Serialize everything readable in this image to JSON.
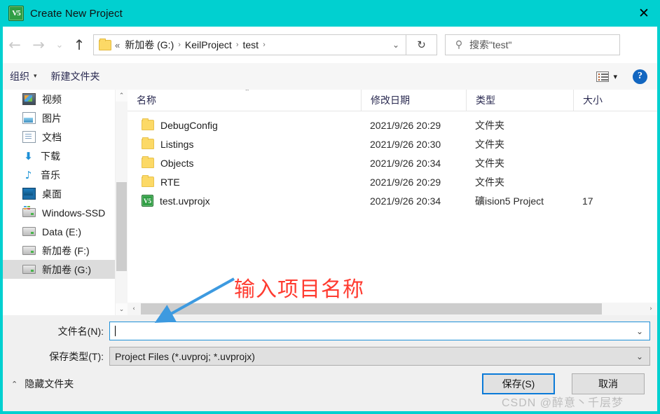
{
  "window": {
    "title": "Create New Project",
    "app_icon": "keil-uvision-icon",
    "close_label": "✕",
    "accent_color": "#01d0d0"
  },
  "nav": {
    "back": "←",
    "forward": "→",
    "recent": "⌄",
    "up": "↑",
    "refresh": "↻",
    "address_dropdown": "⌄",
    "breadcrumbs": [
      {
        "label": "«",
        "type": "overflow"
      },
      {
        "label": "新加卷 (G:)",
        "type": "crumb"
      },
      {
        "label": "KeilProject",
        "type": "crumb"
      },
      {
        "label": "test",
        "type": "crumb"
      }
    ],
    "separator": "›"
  },
  "search": {
    "icon": "search-icon",
    "placeholder": "搜索\"test\""
  },
  "toolbar": {
    "organize_label": "组织",
    "organize_caret": "▾",
    "new_folder_label": "新建文件夹",
    "view_caret": "▾",
    "help_label": "?"
  },
  "sidebar": {
    "items": [
      {
        "label": "视频",
        "icon": "video-icon",
        "selected": false
      },
      {
        "label": "图片",
        "icon": "pictures-icon",
        "selected": false
      },
      {
        "label": "文档",
        "icon": "documents-icon",
        "selected": false
      },
      {
        "label": "下载",
        "icon": "downloads-icon",
        "selected": false
      },
      {
        "label": "音乐",
        "icon": "music-icon",
        "selected": false
      },
      {
        "label": "桌面",
        "icon": "desktop-icon",
        "selected": false
      },
      {
        "label": "Windows-SSD",
        "icon": "ssd-drive-icon",
        "selected": false
      },
      {
        "label": "Data (E:)",
        "icon": "drive-icon",
        "selected": false
      },
      {
        "label": "新加卷 (F:)",
        "icon": "drive-icon",
        "selected": false
      },
      {
        "label": "新加卷 (G:)",
        "icon": "drive-icon",
        "selected": true
      }
    ],
    "scroll_up": "⌃",
    "scroll_down": "⌄"
  },
  "filelist": {
    "columns": {
      "name": "名称",
      "date": "修改日期",
      "type": "类型",
      "size": "大小"
    },
    "sort_caret": "⌃",
    "rows": [
      {
        "name": "DebugConfig",
        "date": "2021/9/26 20:29",
        "type": "文件夹",
        "size": "",
        "icon": "folder-icon"
      },
      {
        "name": "Listings",
        "date": "2021/9/26 20:30",
        "type": "文件夹",
        "size": "",
        "icon": "folder-icon"
      },
      {
        "name": "Objects",
        "date": "2021/9/26 20:34",
        "type": "文件夹",
        "size": "",
        "icon": "folder-icon"
      },
      {
        "name": "RTE",
        "date": "2021/9/26 20:29",
        "type": "文件夹",
        "size": "",
        "icon": "folder-icon"
      },
      {
        "name": "test.uvprojx",
        "date": "2021/9/26 20:34",
        "type": "礦ision5 Project",
        "size": "17",
        "icon": "keil-project-icon"
      }
    ],
    "hscroll_left": "‹",
    "hscroll_right": "›"
  },
  "form": {
    "filename_label": "文件名(N):",
    "filename_value": "",
    "filetype_label": "保存类型(T):",
    "filetype_value": "Project Files (*.uvproj; *.uvprojx)",
    "dropdown_caret": "⌄"
  },
  "actions": {
    "save_label": "保存(S)",
    "cancel_label": "取消",
    "hide_folders_label": "隐藏文件夹",
    "hide_folders_caret": "⌃"
  },
  "annotations": {
    "note_text": "输入项目名称",
    "note_color": "#ff3b30",
    "arrow_color": "#3d9ae0",
    "watermark": "CSDN @醉意丶千层梦"
  }
}
